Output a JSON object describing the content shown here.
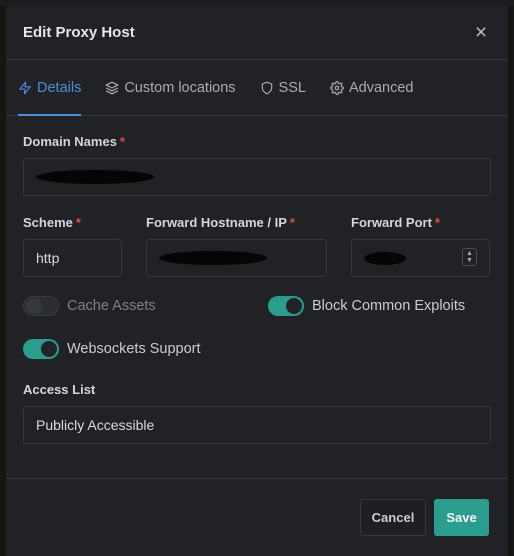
{
  "modal": {
    "title": "Edit Proxy Host",
    "close_glyph": "×"
  },
  "tabs": [
    {
      "label": "Details",
      "icon": "lightning-icon",
      "active": true
    },
    {
      "label": "Custom locations",
      "icon": "layers-icon",
      "active": false
    },
    {
      "label": "SSL",
      "icon": "shield-icon",
      "active": false
    },
    {
      "label": "Advanced",
      "icon": "gear-icon",
      "active": false
    }
  ],
  "form": {
    "domain_names": {
      "label": "Domain Names",
      "required": "*",
      "value_redacted": true
    },
    "scheme": {
      "label": "Scheme",
      "required": "*",
      "value": "http"
    },
    "forward_hostname": {
      "label": "Forward Hostname / IP",
      "required": "*",
      "value_redacted": true
    },
    "forward_port": {
      "label": "Forward Port",
      "required": "*",
      "value_redacted": true
    },
    "cache_assets": {
      "label": "Cache Assets",
      "enabled": false
    },
    "block_exploits": {
      "label": "Block Common Exploits",
      "enabled": true
    },
    "websockets": {
      "label": "Websockets Support",
      "enabled": true
    },
    "access_list": {
      "label": "Access List",
      "value": "Publicly Accessible"
    }
  },
  "footer": {
    "cancel_label": "Cancel",
    "save_label": "Save"
  },
  "colors": {
    "accent_blue": "#4a90d9",
    "accent_teal": "#2a9d8f",
    "required_red": "#e04b4b",
    "modal_bg": "#212225"
  }
}
